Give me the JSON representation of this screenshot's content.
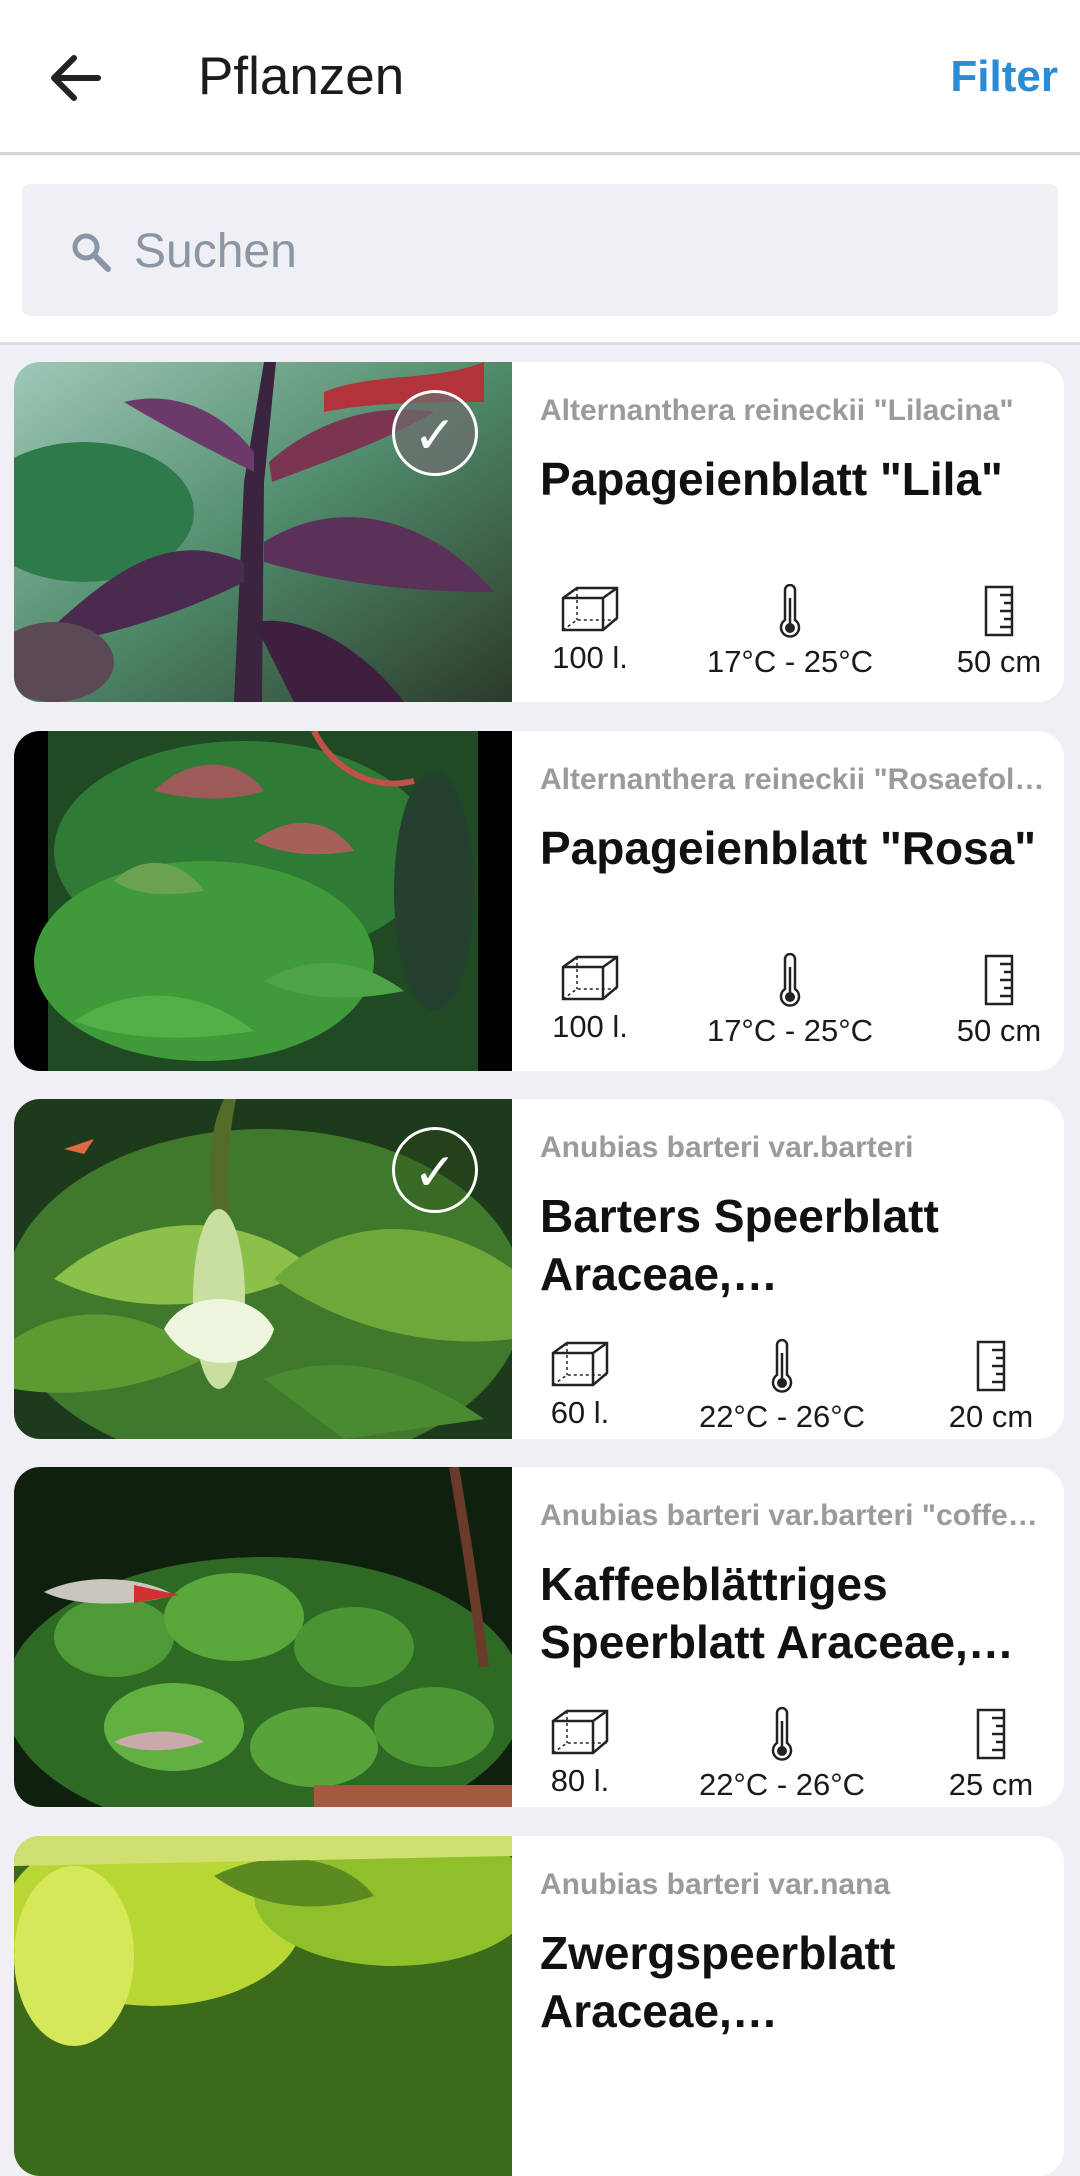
{
  "header": {
    "title": "Pflanzen",
    "filter_label": "Filter"
  },
  "search": {
    "placeholder": "Suchen",
    "value": ""
  },
  "icons": {
    "back": "arrow-left-icon",
    "search": "magnifier-icon",
    "selected": "checkmark-icon",
    "volume": "aquarium-tank-icon",
    "temperature": "thermometer-icon",
    "height": "ruler-icon"
  },
  "colors": {
    "accent": "#2a8bd6",
    "background": "#efeff4",
    "latin_text": "#9b9b9b"
  },
  "plants": [
    {
      "latin": "Alternanthera reineckii \"Lilacina\"",
      "common": "Papageienblatt \"Lila\"",
      "volume": "100 l.",
      "temperature": "17°C - 25°C",
      "height": "50 cm",
      "selected": true,
      "check_glyph": "✓"
    },
    {
      "latin": "Alternanthera reineckii \"Rosaefolia\"",
      "common": "Papageienblatt \"Rosa\"",
      "volume": "100 l.",
      "temperature": "17°C - 25°C",
      "height": "50 cm",
      "selected": false
    },
    {
      "latin": "Anubias barteri var.barteri",
      "common": "Barters Speerblatt Araceae, Aronstabgewächse",
      "volume": "60 l.",
      "temperature": "22°C - 26°C",
      "height": "20 cm",
      "selected": true,
      "check_glyph": "✓"
    },
    {
      "latin": "Anubias barteri var.barteri \"coffeefolia\"",
      "common": "Kaffeeblättriges Speerblatt Araceae, Aronstabgewächse",
      "volume": "80 l.",
      "temperature": "22°C - 26°C",
      "height": "25 cm",
      "selected": false
    },
    {
      "latin": "Anubias barteri var.nana",
      "common": "Zwergspeerblatt Araceae, Aronstabgewächse",
      "volume": "",
      "temperature": "",
      "height": "",
      "selected": false
    }
  ]
}
